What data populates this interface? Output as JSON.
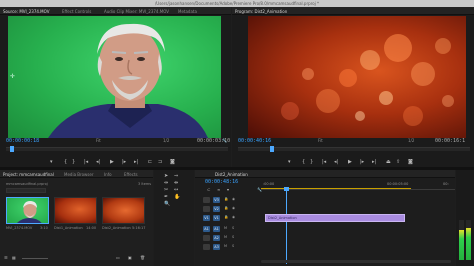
{
  "window": {
    "title": "/Users/jasonhansen/Documents/Adobe/Premiere Pro/8.0/mmcamsaudfinal.prproj *"
  },
  "source_panel": {
    "tabs": [
      "Source: MVI_2374.MOV",
      "Effect Controls",
      "Audio Clip Mixer: MVI_2374.MOV",
      "Metadata"
    ],
    "timecode_in": "00:00:00:18",
    "fit": "Fit",
    "ratio": "1/2",
    "timecode_out": "00:00:03:10"
  },
  "program_panel": {
    "tabs": [
      "Program: Dist2_Animation"
    ],
    "timecode_in": "00:00:40:16",
    "fit": "Fit",
    "ratio": "1/2",
    "timecode_out": "00:00:16:1"
  },
  "project_panel": {
    "tabs": [
      "Project: mmcamsaudfinal",
      "Media Browser",
      "Info",
      "Effects"
    ],
    "file": "mmcamsaudfinal.prproj",
    "items_count": "3 Items",
    "items": [
      {
        "name": "MVI_2374.MOV",
        "duration": "3:10"
      },
      {
        "name": "Dist1_Animation",
        "duration": "14:00"
      },
      {
        "name": "Dist2_Animation",
        "duration": "5:16:17"
      }
    ]
  },
  "timeline_panel": {
    "tab": "Dist2_Animation",
    "timecode": "00:00:48:16",
    "ruler": [
      ":00:00",
      "00:00:05:00",
      "00:"
    ],
    "video_tracks": [
      "V3",
      "V2",
      "V1"
    ],
    "audio_tracks": [
      "A1",
      "A2",
      "A3"
    ],
    "clip_label": "Dist2_Animation"
  },
  "colors": {
    "accent_blue": "#3aa3ff",
    "playhead": "#4da9ff",
    "clip_purple": "#a98ce0",
    "track_active": "#2d5a8c",
    "meter_green": "#2ecf4b"
  }
}
